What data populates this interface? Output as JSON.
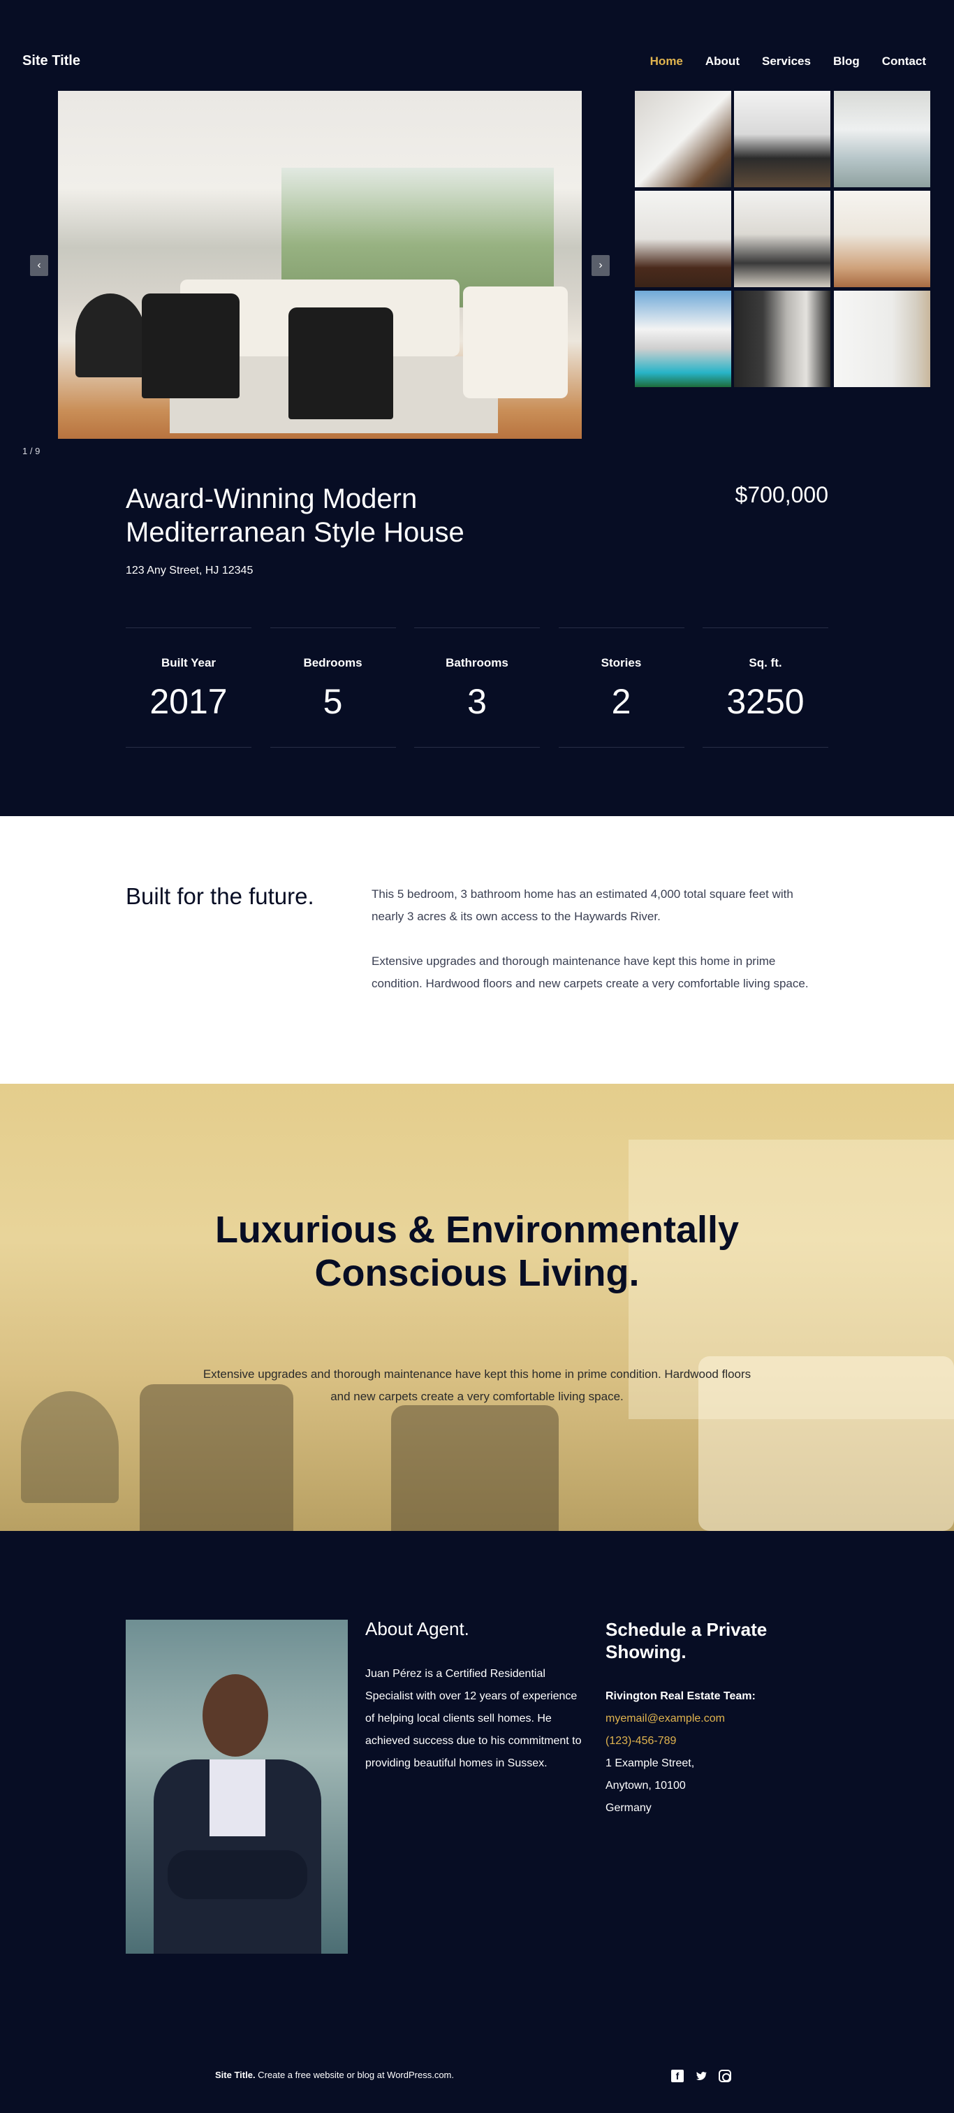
{
  "header": {
    "site_title": "Site Title",
    "nav": [
      {
        "label": "Home",
        "active": true
      },
      {
        "label": "About",
        "active": false
      },
      {
        "label": "Services",
        "active": false
      },
      {
        "label": "Blog",
        "active": false
      },
      {
        "label": "Contact",
        "active": false
      }
    ]
  },
  "gallery": {
    "counter": "1 / 9",
    "prev_icon": "chevron-left-icon",
    "next_icon": "chevron-right-icon",
    "prev_glyph": "‹",
    "next_glyph": "›"
  },
  "property": {
    "title": "Award-Winning Modern Mediterranean Style House",
    "price": "$700,000",
    "address": "123 Any Street, HJ 12345",
    "stats": [
      {
        "label": "Built Year",
        "value": "2017"
      },
      {
        "label": "Bedrooms",
        "value": "5"
      },
      {
        "label": "Bathrooms",
        "value": "3"
      },
      {
        "label": "Stories",
        "value": "2"
      },
      {
        "label": "Sq. ft.",
        "value": "3250"
      }
    ]
  },
  "future": {
    "heading": "Built for the future.",
    "para1": "This 5 bedroom, 3 bathroom home has an estimated 4,000 total square feet with nearly 3 acres & its own access to the Haywards River.",
    "para2": "Extensive upgrades and thorough maintenance have kept this home in prime condition. Hardwood floors and new carpets create a very comfortable living space."
  },
  "luxury": {
    "heading": "Luxurious & Environmentally Conscious Living.",
    "text": "Extensive upgrades and thorough maintenance have kept this home in prime condition. Hardwood floors and new carpets create a very comfortable living space."
  },
  "agent": {
    "about_title": "About Agent.",
    "about_text": "Juan Pérez is a Certified Residential Specialist with over 12 years of experience of helping local clients sell homes. He achieved success due to his commitment to providing beautiful homes in Sussex."
  },
  "schedule": {
    "title": "Schedule a Private Showing.",
    "team": "Rivington Real Estate Team:",
    "email": "myemail@example.com",
    "phone": "(123)-456-789",
    "address_line1": "1 Example Street,",
    "address_line2": "Anytown, 10100",
    "address_line3": "Germany"
  },
  "footer": {
    "site_title": "Site Title.",
    "credit": " Create a free website or blog at WordPress.com.",
    "social": [
      "facebook-icon",
      "twitter-icon",
      "instagram-icon"
    ]
  },
  "colors": {
    "background": "#070d24",
    "accent": "#e0b44f",
    "banner": "#e4cd8c"
  }
}
